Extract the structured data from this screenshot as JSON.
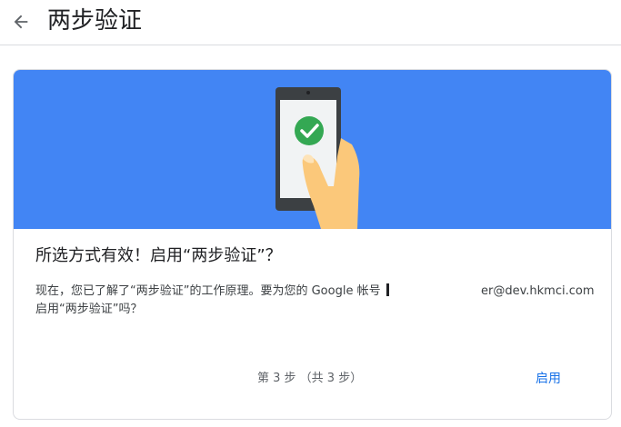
{
  "header": {
    "back_icon": "arrow-back-icon",
    "title": "两步验证"
  },
  "card": {
    "illustration": "phone-checkmark-illustration",
    "heading": "所选方式有效！启用“两步验证”？",
    "body_line1": "现在，您已了解了“两步验证”的工作原理。要为您的 Google 帐号",
    "email": "er@dev.hkmci.com",
    "body_line2": "启用“两步验证”吗？",
    "step_text": "第 3 步 （共 3 步）",
    "enable_label": "启用"
  },
  "colors": {
    "banner": "#4285f4",
    "check": "#34a853",
    "link": "#1a73e8"
  }
}
